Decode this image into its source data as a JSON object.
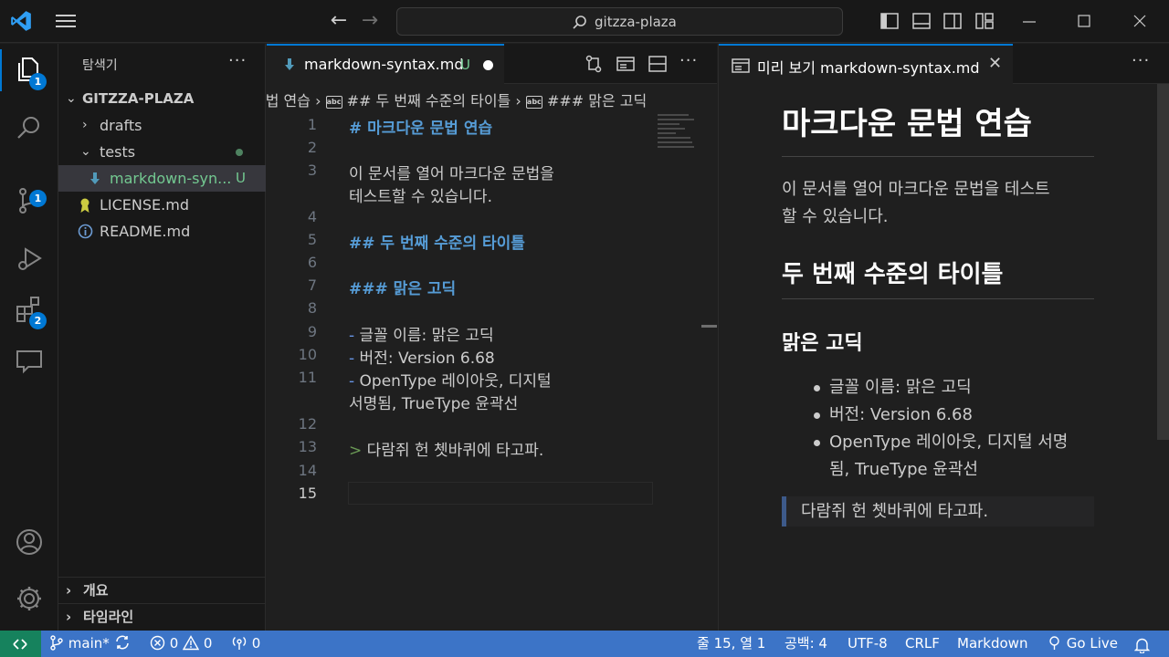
{
  "titlebar": {
    "search_text": "gitzza-plaza"
  },
  "activity_badges": {
    "explorer": "1",
    "scm": "1",
    "extensions": "2"
  },
  "sidebar": {
    "title": "탐색기",
    "more": "···",
    "root": "GITZZA-PLAZA",
    "items": [
      {
        "label": "drafts"
      },
      {
        "label": "tests"
      },
      {
        "label": "markdown-syn...",
        "status": "U"
      },
      {
        "label": "LICENSE.md"
      },
      {
        "label": "README.md"
      }
    ],
    "sections": [
      "개요",
      "타임라인"
    ]
  },
  "editor": {
    "tab_label": "markdown-syntax.md",
    "tab_status": "U",
    "more": "···",
    "breadcrumb": {
      "part1": "문법 연습",
      "part2": "## 두 번째 수준의 타이틀",
      "part3": "### 맑은 고딕",
      "abc": "abc"
    },
    "line_numbers": [
      "1",
      "2",
      "3",
      "4",
      "5",
      "6",
      "7",
      "8",
      "9",
      "10",
      "11",
      "12",
      "13",
      "14",
      "15"
    ],
    "lines": {
      "l1": "# 마크다운 문법 연습",
      "l3a": "이 문서를 열어 마크다운 문법을",
      "l3b": "테스트할 수 있습니다.",
      "l5": "## 두 번째 수준의 타이틀",
      "l7": "### 맑은 고딕",
      "dash": "-",
      "l9": " 글꼴 이름: 맑은 고딕",
      "l10": " 버전: Version 6.68",
      "l11a": " OpenType 레이아웃, 디지털",
      "l11b": "서명됨, TrueType 윤곽선",
      "quote": ">",
      "l13": " 다람쥐 헌 쳇바퀴에 타고파."
    }
  },
  "preview": {
    "tab_label": "미리 보기 markdown-syntax.md",
    "close": "✕",
    "more": "···",
    "h1": "마크다운 문법 연습",
    "p_line1": "이 문서를 열어 마크다운 문법을 테스트",
    "p_line2": "할 수 있습니다.",
    "h2": "두 번째 수준의 타이틀",
    "h3": "맑은 고딕",
    "list": [
      "글꼴 이름: 맑은 고딕",
      "버전: Version 6.68",
      "OpenType 레이아웃, 디지털 서명",
      "됨, TrueType 윤곽선"
    ],
    "blockquote": "다람쥐 헌 쳇바퀴에 타고파."
  },
  "statusbar": {
    "branch": "main*",
    "errors": "0",
    "warnings": "0",
    "ports": "0",
    "cursor": "줄 15, 열 1",
    "indent": "공백: 4",
    "encoding": "UTF-8",
    "eol": "CRLF",
    "language": "Markdown",
    "golive": "Go Live"
  },
  "colors": {
    "accent": "#0078d4",
    "statusbar": "#3c74c7",
    "untracked": "#73c991",
    "heading": "#569cd6"
  }
}
